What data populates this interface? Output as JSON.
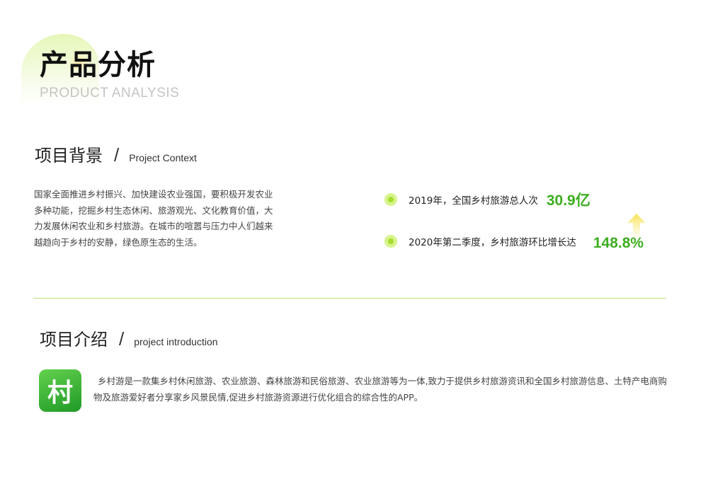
{
  "header": {
    "title": "产品分析",
    "subtitle": "PRODUCT ANALYSIS"
  },
  "background_section": {
    "title_cn": "项目背景",
    "separator": "/",
    "title_en": "Project Context",
    "body": "国家全面推进乡村振兴、加快建设农业强国，要积极开发农业多种功能，挖掘乡村生态休闲、旅游观光、文化教育价值，大力发展休闲农业和乡村旅游。在城市的喧嚣与压力中人们越来越趋向于乡村的安静，绿色原生态的生活。"
  },
  "stats": [
    {
      "label": "2019年，全国乡村旅游总人次",
      "value": "30.9亿"
    },
    {
      "label": "2020年第二季度，乡村旅游环比增长达",
      "value": "148.8%"
    }
  ],
  "intro_section": {
    "title_cn": "项目介绍",
    "separator": "/",
    "title_en": "project introduction",
    "icon_char": "村",
    "body": "乡村游是一款集乡村休闲旅游、农业旅游、森林旅游和民俗旅游、农业旅游等为一体,致力于提供乡村旅游资讯和全国乡村旅游信息、土特产电商购物及旅游爱好者分享家乡风景民情,促进乡村旅游资源进行优化组合的综合性的APP。"
  },
  "colors": {
    "accent_green": "#3cae1f",
    "bullet_green": "#d6f48a",
    "divider": "#b6e27a",
    "arrow_yellow": "#f9e46a"
  },
  "icons": {
    "stat_bullet": "green-dot-icon",
    "growth_arrow": "arrow-up-icon",
    "app_logo": "village-app-icon"
  }
}
